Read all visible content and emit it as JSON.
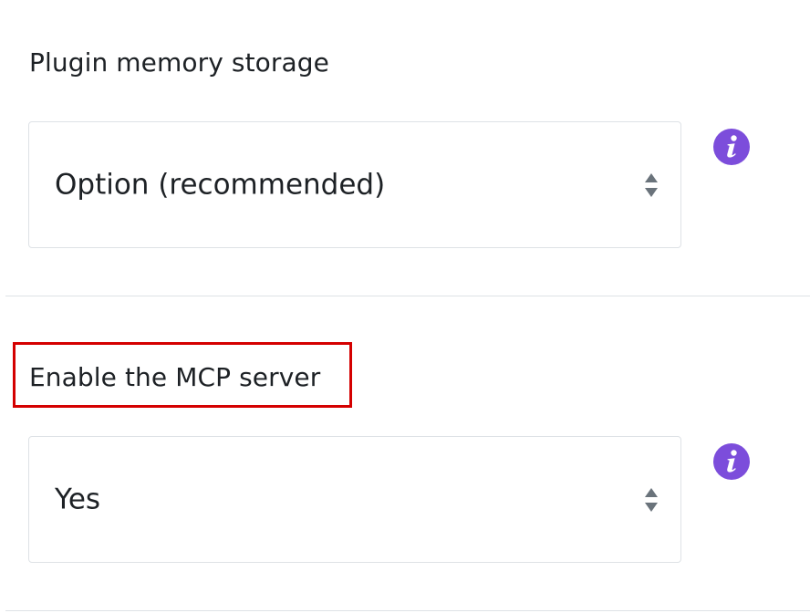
{
  "settings": [
    {
      "label": "Plugin memory storage",
      "selected_value": "Option (recommended)",
      "info_icon": "info-icon"
    },
    {
      "label": "Enable the MCP server",
      "selected_value": "Yes",
      "info_icon": "info-icon",
      "highlighted": true
    }
  ],
  "colors": {
    "info_icon": "#7c4ddb",
    "highlight_border": "#d40000",
    "arrow": "#6a737b"
  }
}
